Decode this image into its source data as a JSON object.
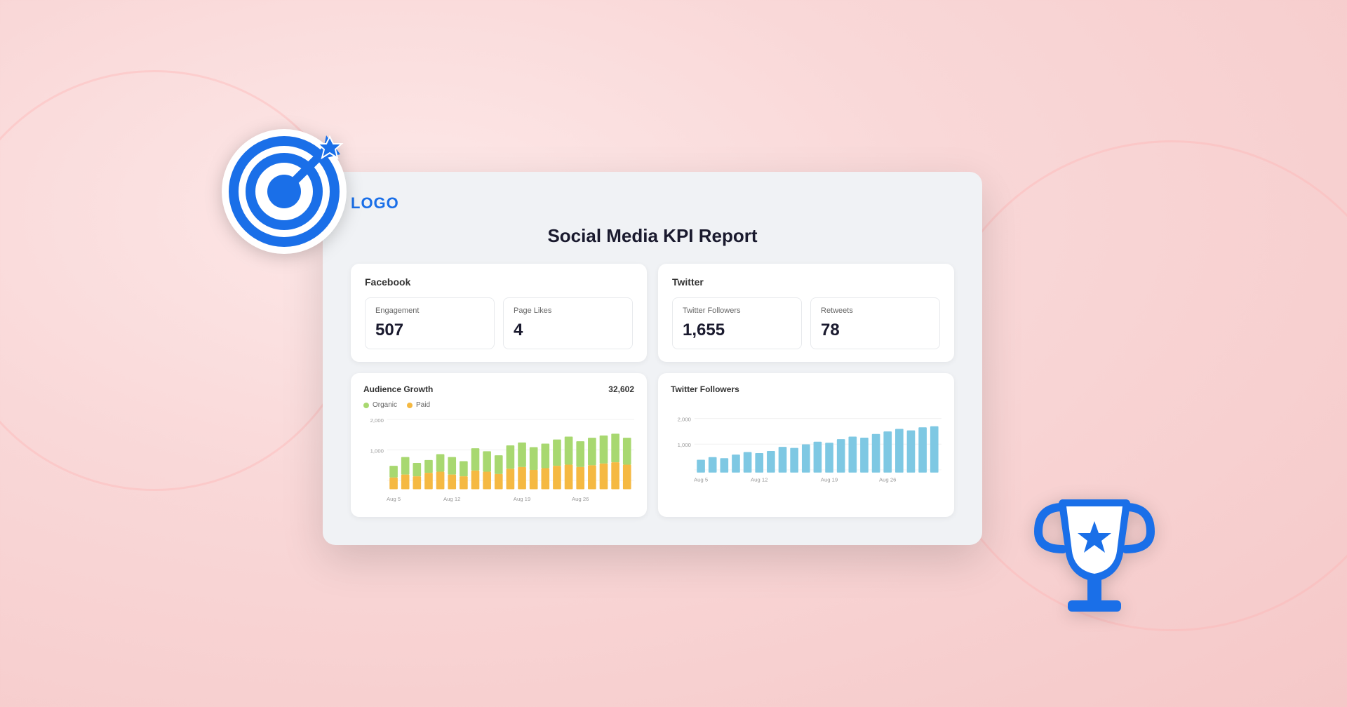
{
  "background_color": "#fce8e8",
  "logo": {
    "text": "LOGO"
  },
  "report": {
    "title": "Social Media KPI Report"
  },
  "facebook_section": {
    "title": "Facebook",
    "metrics": [
      {
        "label": "Engagement",
        "value": "507"
      },
      {
        "label": "Page Likes",
        "value": "4"
      }
    ]
  },
  "twitter_section": {
    "title": "Twitter",
    "metrics": [
      {
        "label": "Twitter Followers",
        "value": "1,655"
      },
      {
        "label": "Retweets",
        "value": "78"
      }
    ]
  },
  "audience_growth_chart": {
    "title": "Audience Growth",
    "total": "32,602",
    "legend": [
      {
        "label": "Organic",
        "color": "#a8d870"
      },
      {
        "label": "Paid",
        "color": "#f5b942"
      }
    ],
    "y_labels": [
      "2,000",
      "1,000",
      ""
    ],
    "x_labels": [
      "Aug 5",
      "Aug 12",
      "Aug 19",
      "Aug 26"
    ],
    "bars": [
      [
        40,
        20
      ],
      [
        55,
        25
      ],
      [
        45,
        22
      ],
      [
        50,
        28
      ],
      [
        60,
        30
      ],
      [
        55,
        25
      ],
      [
        48,
        22
      ],
      [
        70,
        32
      ],
      [
        65,
        30
      ],
      [
        58,
        26
      ],
      [
        75,
        35
      ],
      [
        80,
        38
      ],
      [
        72,
        33
      ],
      [
        78,
        36
      ],
      [
        85,
        40
      ],
      [
        90,
        42
      ],
      [
        82,
        38
      ],
      [
        88,
        41
      ],
      [
        92,
        44
      ],
      [
        95,
        46
      ],
      [
        88,
        42
      ]
    ]
  },
  "twitter_followers_chart": {
    "title": "Twitter Followers",
    "y_labels": [
      "2,000",
      "1,000",
      ""
    ],
    "x_labels": [
      "Aug 5",
      "Aug 12",
      "Aug 19",
      "Aug 26"
    ],
    "bar_color": "#7ec8e3",
    "bars": [
      25,
      30,
      28,
      35,
      40,
      38,
      42,
      50,
      48,
      55,
      60,
      58,
      65,
      70,
      68,
      75,
      80,
      85,
      82,
      88,
      90
    ]
  }
}
